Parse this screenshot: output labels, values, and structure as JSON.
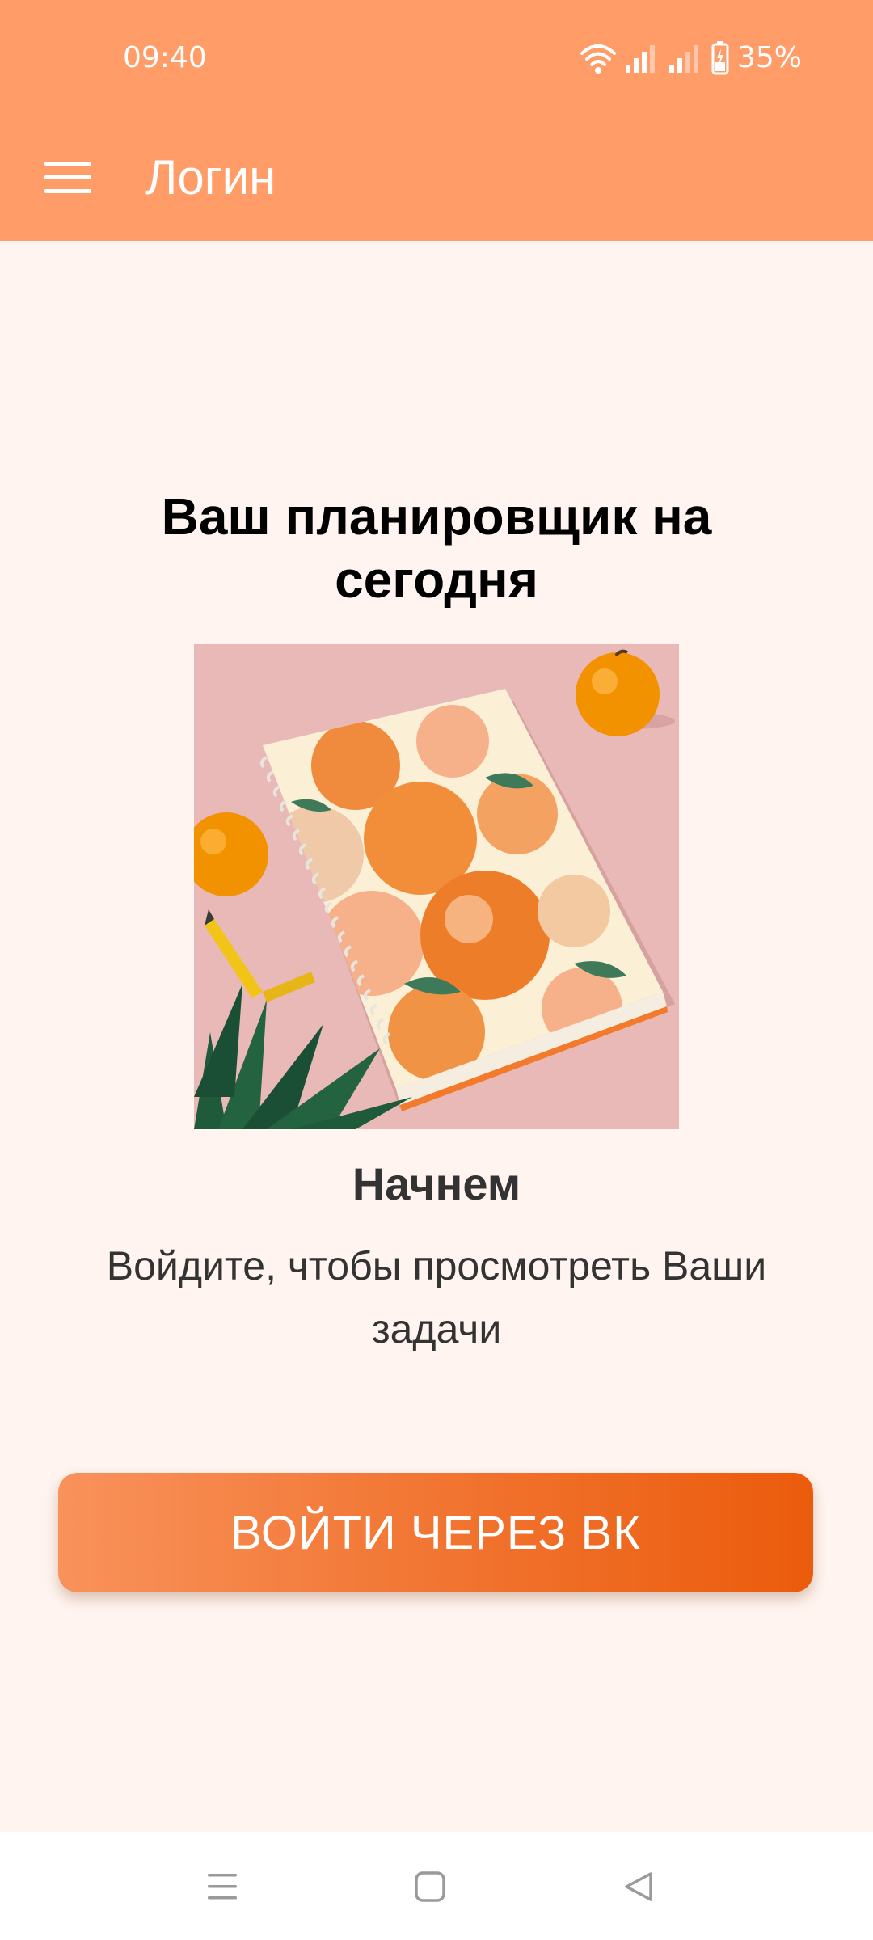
{
  "status_bar": {
    "time": "09:40",
    "battery_percent": "35%",
    "icons": [
      "wifi-icon",
      "signal-icon",
      "signal-icon",
      "battery-charging-icon"
    ]
  },
  "app_bar": {
    "title": "Логин",
    "menu_icon": "hamburger-menu-icon"
  },
  "main": {
    "title": "Ваш планировщик на сегодня",
    "image_description_icon": "notebook-illustration",
    "subtitle": "Начнем",
    "description": "Войдите, чтобы просмотреть Ваши задачи",
    "login_button_label": "ВОЙТИ ЧЕРЕЗ ВК"
  },
  "nav_bar": {
    "buttons": [
      "recent-apps-icon",
      "home-icon",
      "back-icon"
    ]
  },
  "colors": {
    "top_bar": "#FF9C68",
    "background": "#FFF4EF",
    "button_gradient_start": "#F9925B",
    "button_gradient_end": "#EB5B0C"
  }
}
